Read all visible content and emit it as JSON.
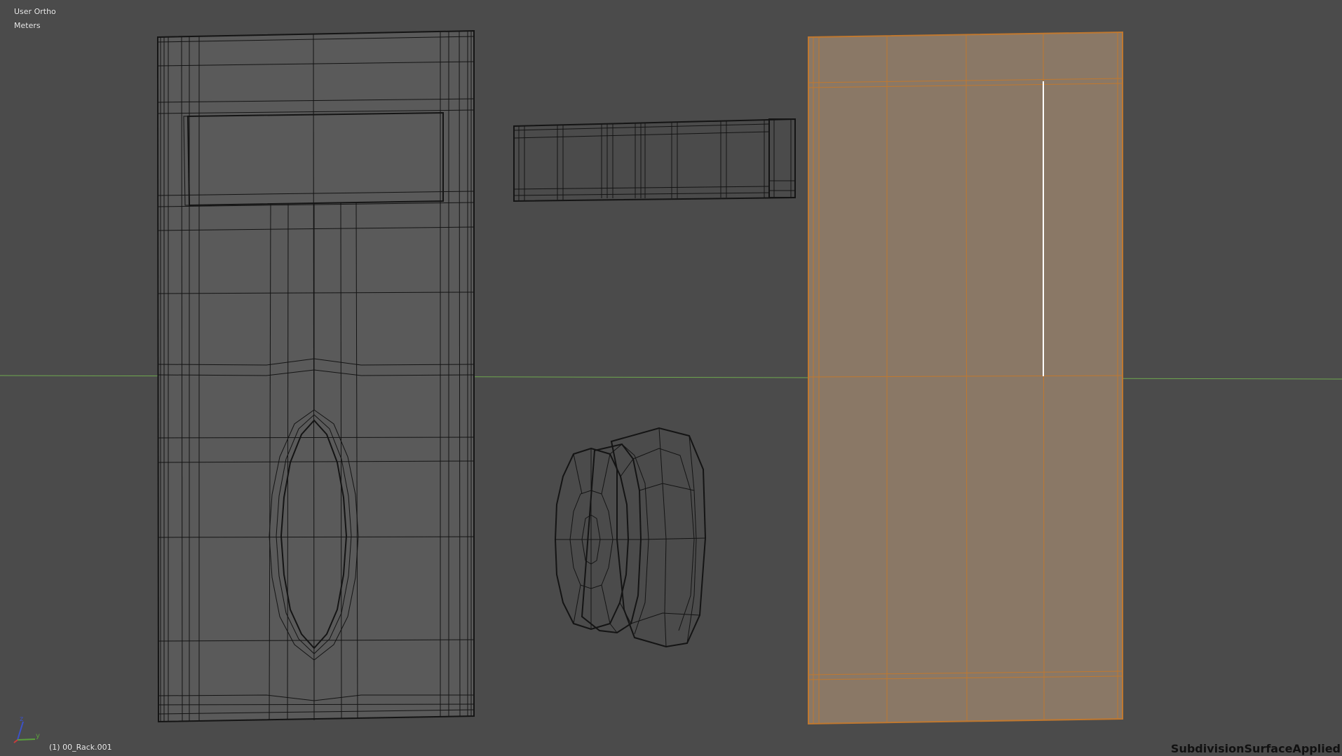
{
  "viewport": {
    "view_name": "User Ortho",
    "units": "Meters",
    "active_object": "(1) 00_Rack.001",
    "modifier_label": "SubdivisionSurfaceApplied"
  },
  "axis_gizmo": {
    "z_label": "z",
    "y_label": "y"
  },
  "colors": {
    "background": "#4b4b4b",
    "mesh_face": "#5a5a5a",
    "wire": "#141414",
    "selected_face": "#8a7866",
    "selected_edge": "#c0782f",
    "active_edge": "#ffffff",
    "y_axis_line": "#6fa84f"
  }
}
